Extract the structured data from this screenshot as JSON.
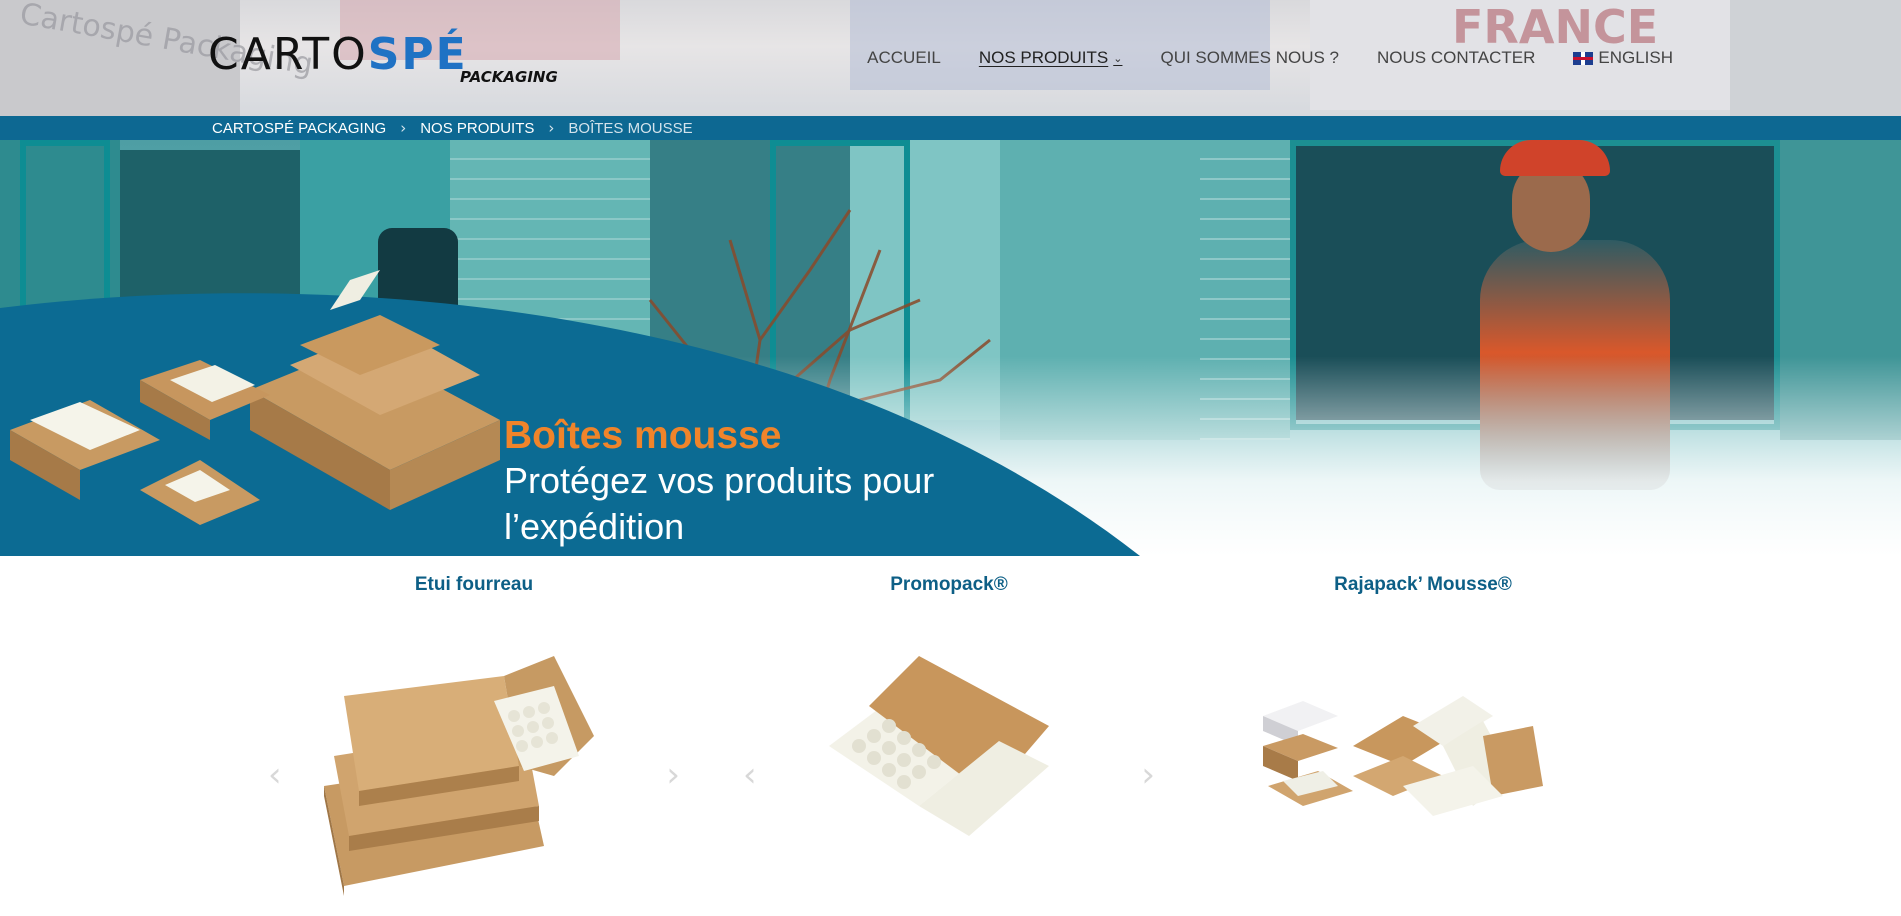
{
  "header": {
    "logo": {
      "part_a": "CARTO",
      "part_b": "SPÉ",
      "subtitle": "PACKAGING"
    },
    "nav": [
      {
        "label": "ACCUEIL",
        "active": false
      },
      {
        "label": "NOS PRODUITS",
        "active": true,
        "icon": "chevron-down-icon"
      },
      {
        "label": "QUI SOMMES NOUS ?",
        "active": false
      },
      {
        "label": "NOUS CONTACTER",
        "active": false
      },
      {
        "label": "ENGLISH",
        "active": false,
        "icon": "uk-flag-icon"
      }
    ],
    "background_text": {
      "left": "Cartospé Packaging",
      "right": "FRANCE"
    }
  },
  "breadcrumb": [
    {
      "label": "CARTOSPÉ PACKAGING"
    },
    {
      "label": "NOS PRODUITS"
    },
    {
      "label": "BOÎTES MOUSSE"
    }
  ],
  "breadcrumb_separator": "›",
  "hero": {
    "title": "Boîtes mousse",
    "subtitle": "Protégez vos produits pour l’expédition"
  },
  "products": [
    {
      "title": "Etui fourreau"
    },
    {
      "title": "Promopack®"
    },
    {
      "title": "Rajapack’ Mousse®"
    }
  ],
  "carousel": {
    "prev": "‹",
    "next": "›"
  },
  "colors": {
    "breadcrumb_bg": "#0d6892",
    "hero_banner_blue": "#0c6b93",
    "hero_title_orange": "#f0842a",
    "product_title": "#0d5f86",
    "logo_blue": "#1f72c4"
  }
}
